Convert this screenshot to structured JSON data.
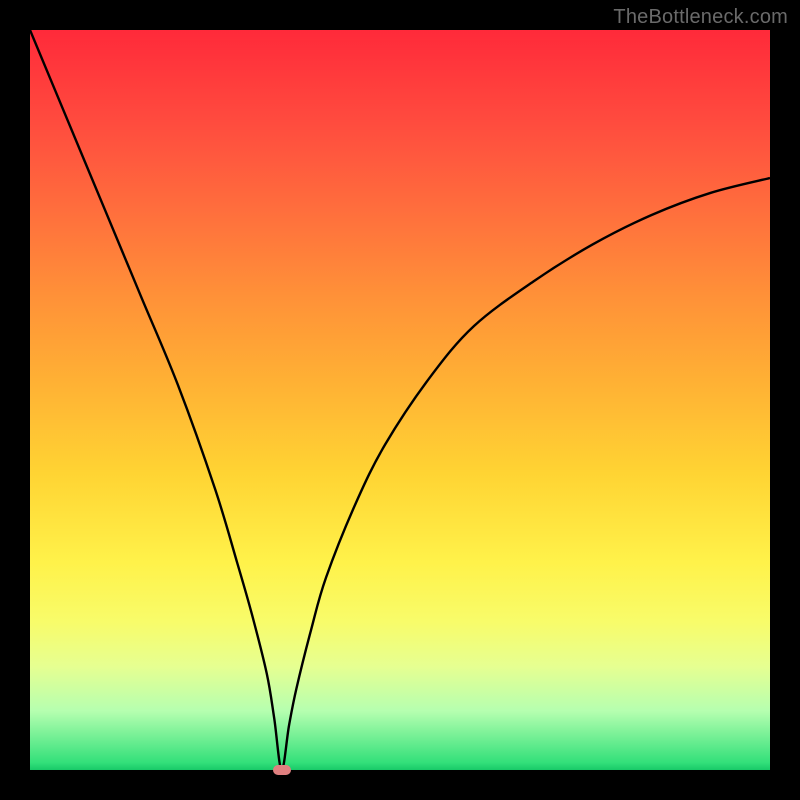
{
  "watermark": "TheBottleneck.com",
  "colors": {
    "curve_stroke": "#000000",
    "marker_fill": "#e08080"
  },
  "chart_data": {
    "type": "line",
    "title": "",
    "xlabel": "",
    "ylabel": "",
    "xlim": [
      0,
      100
    ],
    "ylim": [
      0,
      100
    ],
    "grid": false,
    "legend": false,
    "annotations": [
      {
        "name": "minimum-marker",
        "x": 34,
        "y": 0
      }
    ],
    "series": [
      {
        "name": "bottleneck-curve",
        "x": [
          0,
          5,
          10,
          15,
          20,
          25,
          28,
          30,
          32,
          33,
          34,
          35,
          36,
          38,
          40,
          44,
          48,
          54,
          60,
          68,
          76,
          84,
          92,
          100
        ],
        "y": [
          100,
          88,
          76,
          64,
          52,
          38,
          28,
          21,
          13,
          7,
          0,
          6,
          11,
          19,
          26,
          36,
          44,
          53,
          60,
          66,
          71,
          75,
          78,
          80
        ]
      }
    ]
  }
}
